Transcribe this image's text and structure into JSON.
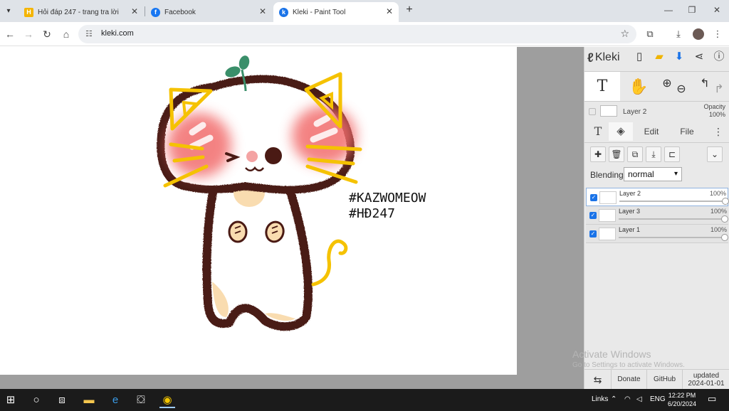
{
  "browser": {
    "tabs": [
      {
        "title": "Hỏi đáp 247 - trang tra lời",
        "favicon": "H"
      },
      {
        "title": "Facebook",
        "favicon": "f"
      },
      {
        "title": "Kleki - Paint Tool",
        "favicon": "k"
      }
    ],
    "url": "kleki.com"
  },
  "panel": {
    "brand": "Kleki",
    "layer_name": "Layer 2",
    "opacity_label": "Opacity",
    "opacity_value": "100%",
    "tabs": [
      "Edit",
      "File"
    ],
    "blending_label": "Blending",
    "blending_value": "normal",
    "layers": [
      {
        "name": "Layer 2",
        "opacity": "100%"
      },
      {
        "name": "Layer 3",
        "opacity": "100%"
      },
      {
        "name": "Layer 1",
        "opacity": "100%"
      }
    ],
    "footer": {
      "donate": "Donate",
      "github": "GitHub",
      "updated": "updated",
      "date": "2024-01-01"
    }
  },
  "canvas": {
    "text_line1": "#KAZWOMEOW",
    "text_line2": "#HĐ247"
  },
  "watermark": {
    "title": "Activate Windows",
    "subtitle": "Go to Settings to activate Windows."
  },
  "taskbar": {
    "links": "Links",
    "lang": "ENG",
    "time": "12:22 PM",
    "date": "6/20/2024"
  },
  "colors": {
    "stroke": "#4a1a14",
    "cheek": "#f26d6d",
    "whisker": "#f5c200",
    "tan": "#f9dcb0",
    "leaf": "#3a8f6a"
  }
}
